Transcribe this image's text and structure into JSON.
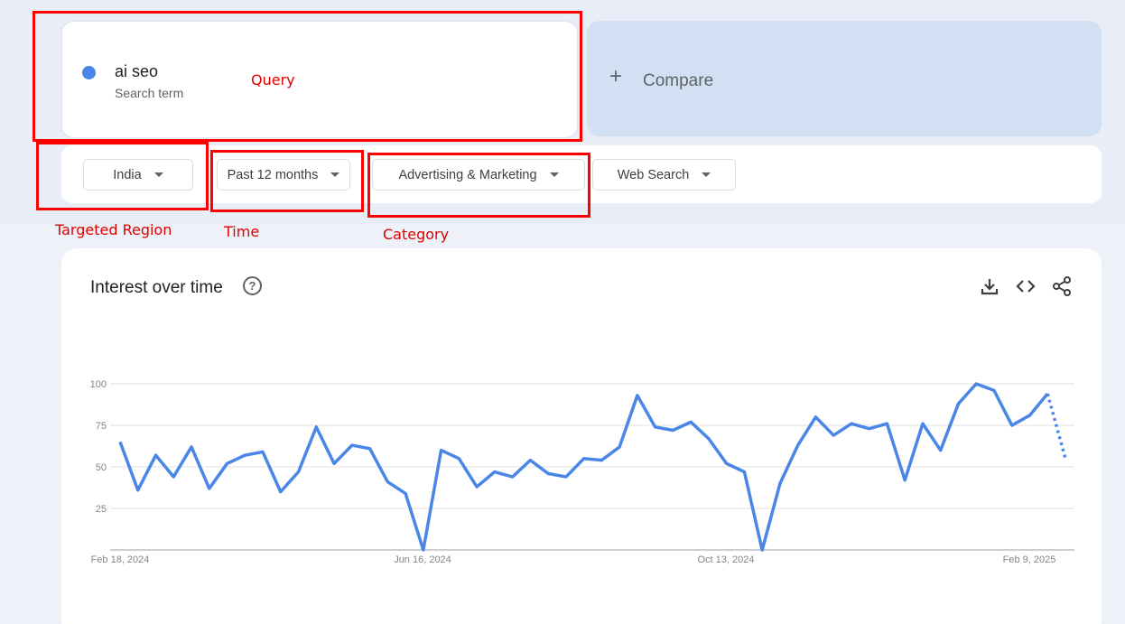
{
  "query": {
    "term": "ai seo",
    "subtitle": "Search term",
    "dot_color": "#4a86e8"
  },
  "compare": {
    "label": "Compare",
    "icon": "plus-icon"
  },
  "filters": {
    "region": "India",
    "time": "Past 12 months",
    "category": "Advertising & Marketing",
    "search_type": "Web Search"
  },
  "annotations": {
    "query": "Query",
    "region": "Targeted Region",
    "time": "Time",
    "category": "Category",
    "color": "#ff0000"
  },
  "chart_section": {
    "title": "Interest over time",
    "icons": [
      "help-icon",
      "download-icon",
      "embed-icon",
      "share-icon"
    ]
  },
  "chart_data": {
    "type": "line",
    "x_tick_labels": [
      "Feb 18, 2024",
      "Jun 16, 2024",
      "Oct 13, 2024",
      "Feb 9, 2025"
    ],
    "y_ticks": [
      25,
      50,
      75,
      100
    ],
    "ylim": [
      0,
      100
    ],
    "grid": true,
    "series": [
      {
        "color": "#4a86e8",
        "values": [
          65,
          36,
          57,
          44,
          62,
          37,
          52,
          57,
          59,
          35,
          47,
          74,
          52,
          63,
          61,
          41,
          34,
          0,
          60,
          55,
          38,
          47,
          44,
          54,
          46,
          44,
          55,
          54,
          62,
          93,
          74,
          72,
          77,
          67,
          52,
          47,
          0,
          40,
          63,
          80,
          69,
          76,
          73,
          76,
          42,
          76,
          60,
          88,
          100,
          96,
          75,
          81,
          94,
          55
        ],
        "partial_last_segment": true
      }
    ]
  }
}
